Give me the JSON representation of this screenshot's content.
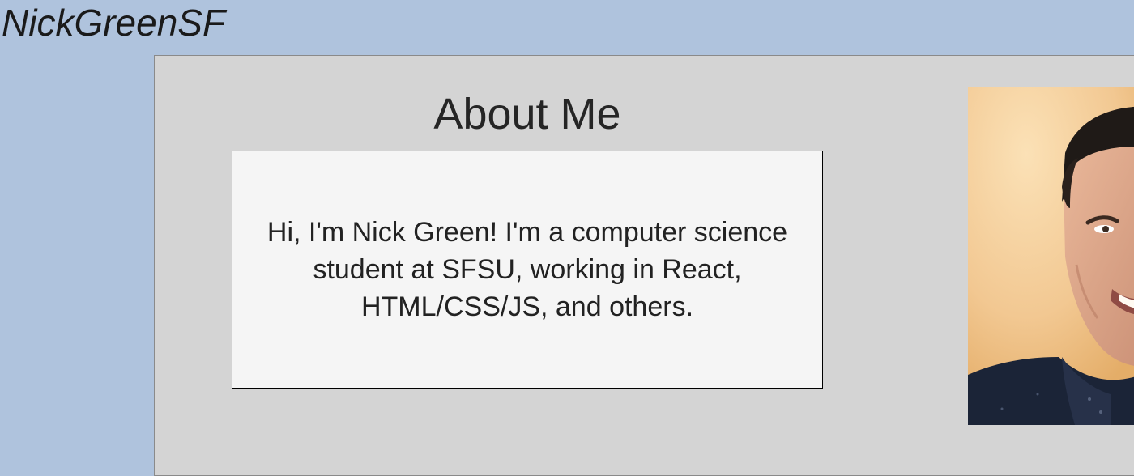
{
  "header": {
    "site_title": "NickGreenSF"
  },
  "about": {
    "heading": "About Me",
    "text": "Hi, I'm Nick Green! I'm a computer science student at SFSU, working in React, HTML/CSS/JS, and others."
  },
  "photo": {
    "subject": "profile-photo"
  },
  "colors": {
    "page_background": "#afc3dd",
    "panel_background": "#d4d4d4",
    "text_box_background": "#f5f5f5",
    "text": "#222222"
  }
}
